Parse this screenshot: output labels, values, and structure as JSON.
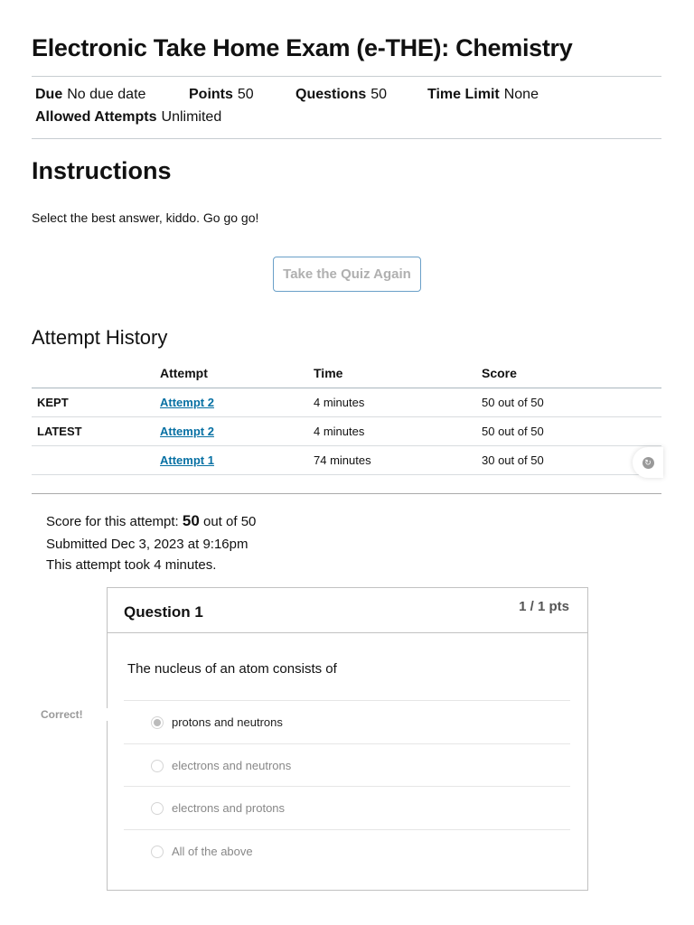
{
  "title": "Electronic Take Home Exam (e-THE): Chemistry",
  "meta": {
    "due_label": "Due",
    "due": "No due date",
    "points_label": "Points",
    "points": "50",
    "questions_label": "Questions",
    "questions": "50",
    "time_limit_label": "Time Limit",
    "time_limit": "None",
    "attempts_label": "Allowed Attempts",
    "attempts": "Unlimited"
  },
  "instructions": {
    "heading": "Instructions",
    "text": "Select the best answer, kiddo.  Go go go!"
  },
  "retake_button": "Take the Quiz Again",
  "history": {
    "heading": "Attempt History",
    "columns": [
      "",
      "Attempt",
      "Time",
      "Score"
    ],
    "rows": [
      {
        "label": "KEPT",
        "attempt": "Attempt 2",
        "time": "4 minutes",
        "score": "50 out of 50"
      },
      {
        "label": "LATEST",
        "attempt": "Attempt 2",
        "time": "4 minutes",
        "score": "50 out of 50"
      },
      {
        "label": "",
        "attempt": "Attempt 1",
        "time": "74 minutes",
        "score": "30 out of 50"
      }
    ]
  },
  "summary": {
    "score_prefix": "Score for this attempt:",
    "score": "50",
    "score_suffix": "out of 50",
    "submitted": "Submitted Dec 3, 2023 at 9:16pm",
    "duration": "This attempt took 4 minutes."
  },
  "question": {
    "title": "Question 1",
    "points": "1 / 1 pts",
    "text": "The nucleus of an atom consists of",
    "correct_label": "Correct!",
    "answers": [
      "protons and neutrons",
      "electrons and neutrons",
      "electrons and protons",
      "All of the above"
    ]
  }
}
